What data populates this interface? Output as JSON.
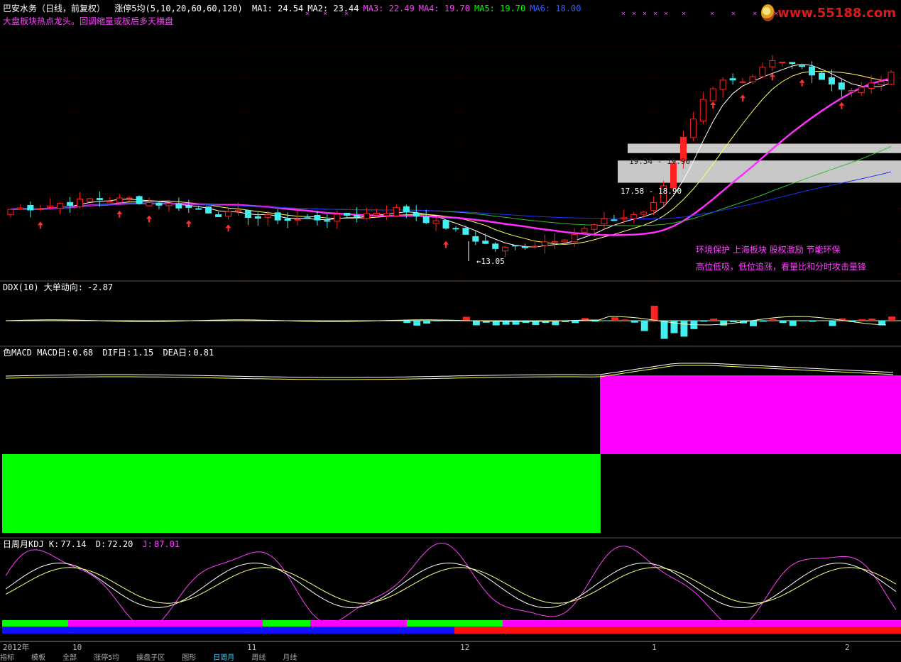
{
  "main_header": {
    "name": "巴安水务（日线，前复权）",
    "ma_title": "涨停5均(5,10,20,60,60,120)",
    "ma_values": [
      {
        "label": "MA1:",
        "value": "24.54",
        "color": "#ffffff"
      },
      {
        "label": "MA2:",
        "value": "23.44",
        "color": "#ffffff"
      },
      {
        "label": "MA3:",
        "value": "22.49",
        "color": "#ff40ff"
      },
      {
        "label": "MA4:",
        "value": "19.70",
        "color": "#ff40ff"
      },
      {
        "label": "MA5:",
        "value": "19.70",
        "color": "#00ff00"
      },
      {
        "label": "MA6:",
        "value": "18.00",
        "color": "#3060ff"
      }
    ],
    "subtitle": "大盘板块热点龙头。回调缩量或板后多天横盘"
  },
  "logo_text": "www.55188.com",
  "annotations": {
    "low_label": "13.05",
    "band_upper": "19.34 - 19.90",
    "band_lower": "17.58 - 18.90",
    "concepts": "环境保护  上海板块  股权激励  节能环保",
    "advice": "高位低吸，低位追涨，看量比和分时攻击量锋"
  },
  "ddx_header": {
    "label": "DDX(10) 大单动向:",
    "value": "-2.87"
  },
  "macd_header": {
    "label": "色MACD MACD日:",
    "macd": "0.68",
    "dif_label": "DIF日:",
    "dif": "1.15",
    "dea_label": "DEA日:",
    "dea": "0.81"
  },
  "kdj_header": {
    "label": "日周月KDJ K:",
    "k": "77.14",
    "d_label": "D:",
    "d": "72.20",
    "j_label": "J:",
    "j": "87.01"
  },
  "time_axis": [
    "2012年",
    "10",
    "11",
    "12",
    "1",
    "2"
  ],
  "bottom_tabs": [
    "指标",
    "模板",
    "全部",
    "涨停5均",
    "操盘子区",
    "图形",
    "日周月",
    "周线",
    "月线"
  ],
  "colors": {
    "up": "#ff2020",
    "down": "#40f0f0",
    "limit": "#2060ff",
    "ma_white": "#ffffff",
    "ma_yellow": "#ffff60",
    "ma_magenta": "#ff30ff",
    "ma_green": "#30c030",
    "ma_blue": "#2030ff",
    "macd_pos": "#ff00ff",
    "macd_neg": "#00ff00"
  },
  "chart_data": [
    {
      "type": "candlestick",
      "title": "巴安水务（日线，前复权）",
      "low_marker": 13.05,
      "price_bands": [
        [
          19.34,
          19.9
        ],
        [
          17.58,
          18.9
        ]
      ],
      "ylim": [
        12.0,
        27.0
      ],
      "ohlc_first_day": [
        15.4,
        16.3,
        15.0,
        16.0
      ],
      "ohlc_last_day": [
        23.4,
        24.2,
        23.0,
        24.0
      ]
    },
    {
      "type": "bar",
      "title": "DDX(10) 大单动向",
      "last_value": -2.87
    },
    {
      "type": "bar",
      "title": "色MACD",
      "macd": 0.68,
      "dif": 1.15,
      "dea": 0.81
    },
    {
      "type": "line",
      "title": "日周月KDJ",
      "k": 77.14,
      "d": 72.2,
      "j": 87.01
    }
  ]
}
